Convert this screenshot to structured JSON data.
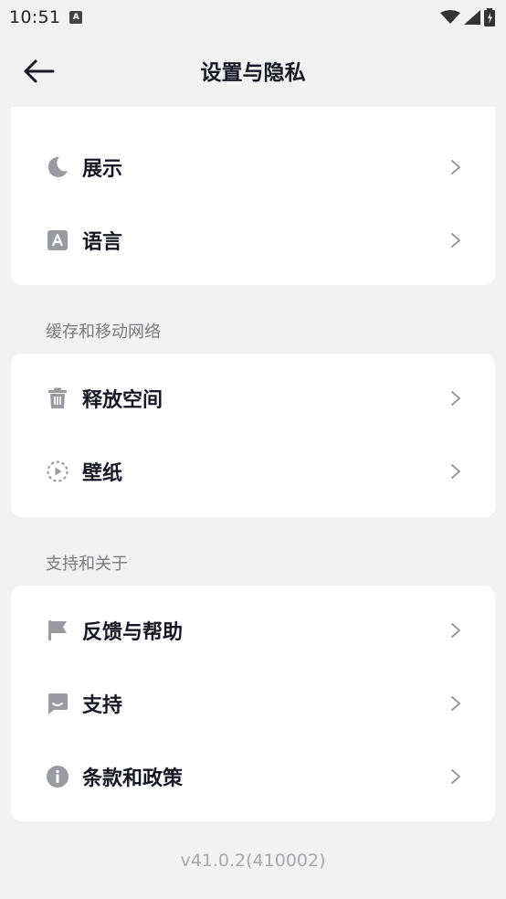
{
  "status_bar": {
    "time": "10:51",
    "notification_glyph": "A"
  },
  "header": {
    "title": "设置与隐私"
  },
  "section1": {
    "items": [
      {
        "label": "展示",
        "icon": "moon-icon"
      },
      {
        "label": "语言",
        "icon": "language-icon"
      }
    ]
  },
  "section2": {
    "title": "缓存和移动网络",
    "items": [
      {
        "label": "释放空间",
        "icon": "trash-icon"
      },
      {
        "label": "壁纸",
        "icon": "wallpaper-icon"
      }
    ]
  },
  "section3": {
    "title": "支持和关于",
    "items": [
      {
        "label": "反馈与帮助",
        "icon": "flag-icon"
      },
      {
        "label": "支持",
        "icon": "chat-icon"
      },
      {
        "label": "条款和政策",
        "icon": "info-icon"
      }
    ]
  },
  "footer": {
    "version": "v41.0.2(410002)"
  },
  "colors": {
    "background": "#f2f2f2",
    "card": "#ffffff",
    "icon": "#9a9ba0",
    "text": "#161823"
  }
}
